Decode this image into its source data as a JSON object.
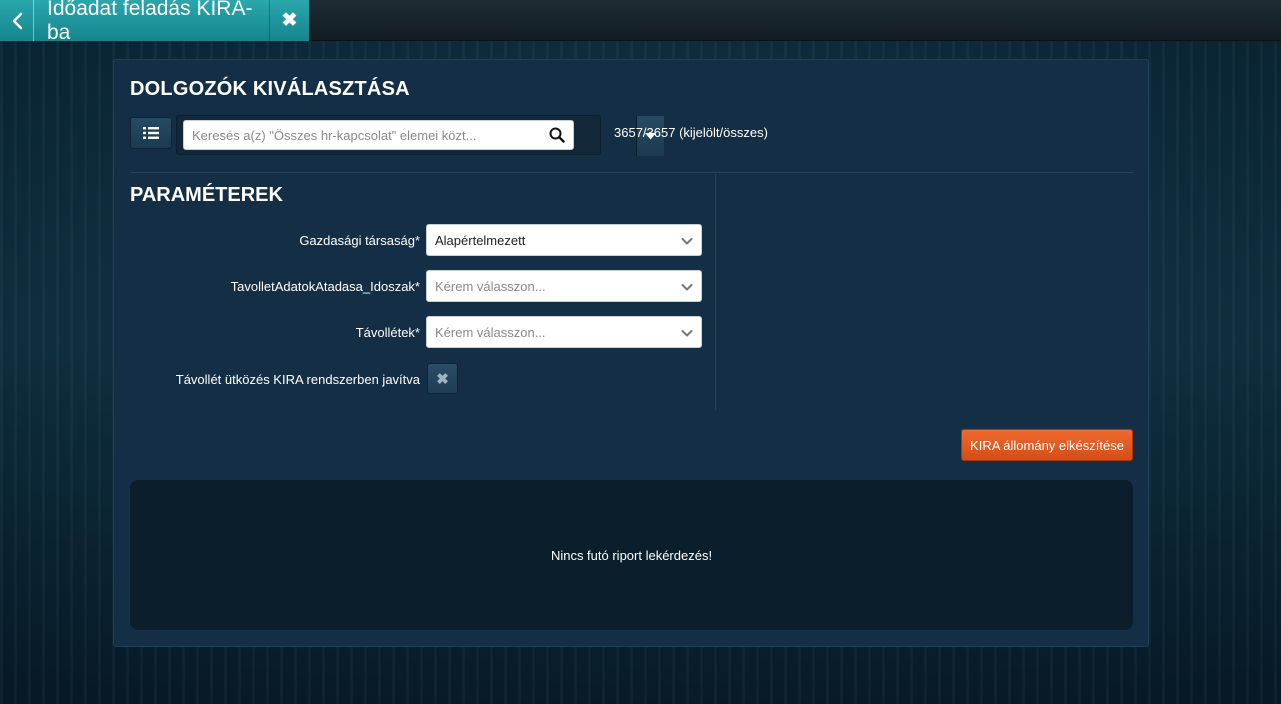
{
  "header": {
    "tab_title": "Időadat feladás KIRA-ba",
    "back_icon": "chevron-left-icon",
    "close_icon": "close-icon"
  },
  "employees": {
    "title": "DOLGOZÓK KIVÁLASZTÁSA",
    "search_placeholder": "Keresés a(z) \"Összes hr-kapcsolat\" elemei közt...",
    "search_value": "",
    "count_text": "3657/3657 (kijelölt/összes)"
  },
  "params": {
    "title": "PARAMÉTEREK",
    "fields": [
      {
        "label": "Gazdasági társaság*",
        "value": "Alapértelmezett",
        "is_placeholder": false
      },
      {
        "label": "TavolletAdatokAtadasa_Idoszak*",
        "value": "Kérem válasszon...",
        "is_placeholder": true
      },
      {
        "label": "Távollétek*",
        "value": "Kérem válasszon...",
        "is_placeholder": true
      }
    ],
    "toggle": {
      "label": "Távollét ütközés KIRA rendszerben javítva",
      "checked": false
    }
  },
  "actions": {
    "generate_label": "KIRA állomány elkészítése"
  },
  "report": {
    "status_text": "Nincs futó riport lekérdezés!"
  },
  "colors": {
    "tab_accent": "#1f9aa1",
    "panel_bg": "#142f45",
    "primary_button": "#e25a20",
    "report_bg": "#0b1e2b"
  }
}
